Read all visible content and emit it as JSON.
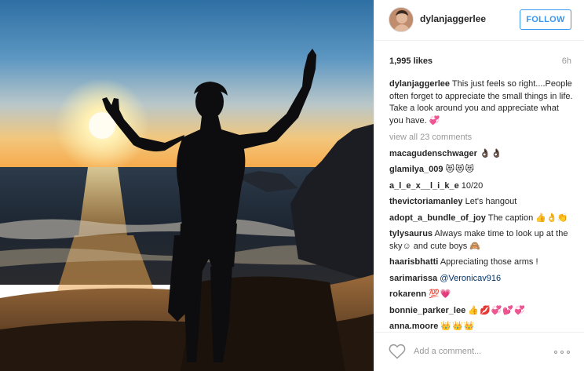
{
  "post": {
    "username": "dylanjaggerlee",
    "follow_label": "FOLLOW",
    "likes": "1,995 likes",
    "age": "6h",
    "caption_user": "dylanjaggerlee",
    "caption_text": "This just feels so right....People often forget to appreciate the small things in life. Take a look around you and appreciate what you have. 💞",
    "view_all": "view all 23 comments"
  },
  "comments": [
    {
      "user": "macagudenschwager",
      "text": "👌🏿👌🏿"
    },
    {
      "user": "glamilya_009",
      "text": "😻😻😻"
    },
    {
      "user": "a_l_e_x__l_i_k_e",
      "text": "10/20"
    },
    {
      "user": "thevictoriamanley",
      "text": "Let's hangout"
    },
    {
      "user": "adopt_a_bundle_of_joy",
      "text": "The caption 👍👌👏"
    },
    {
      "user": "tylysaurus",
      "text": "Always make time to look up at the sky☺ and cute boys 🙈"
    },
    {
      "user": "haarisbhatti",
      "text": "Appreciating those arms !"
    },
    {
      "user": "sarimarissa",
      "text": "@Veronicav916"
    },
    {
      "user": "rokarenn",
      "text": "💯💗"
    },
    {
      "user": "bonnie_parker_lee",
      "text": "👍💋💞💕💞"
    },
    {
      "user": "anna.moore",
      "text": "👑👑👑"
    }
  ],
  "composer": {
    "placeholder": "Add a comment..."
  },
  "icons": {
    "like": "heart-outline-icon",
    "options": "more-options-icon"
  },
  "colors": {
    "accent": "#3897f0",
    "muted": "#999999",
    "text": "#262626"
  }
}
